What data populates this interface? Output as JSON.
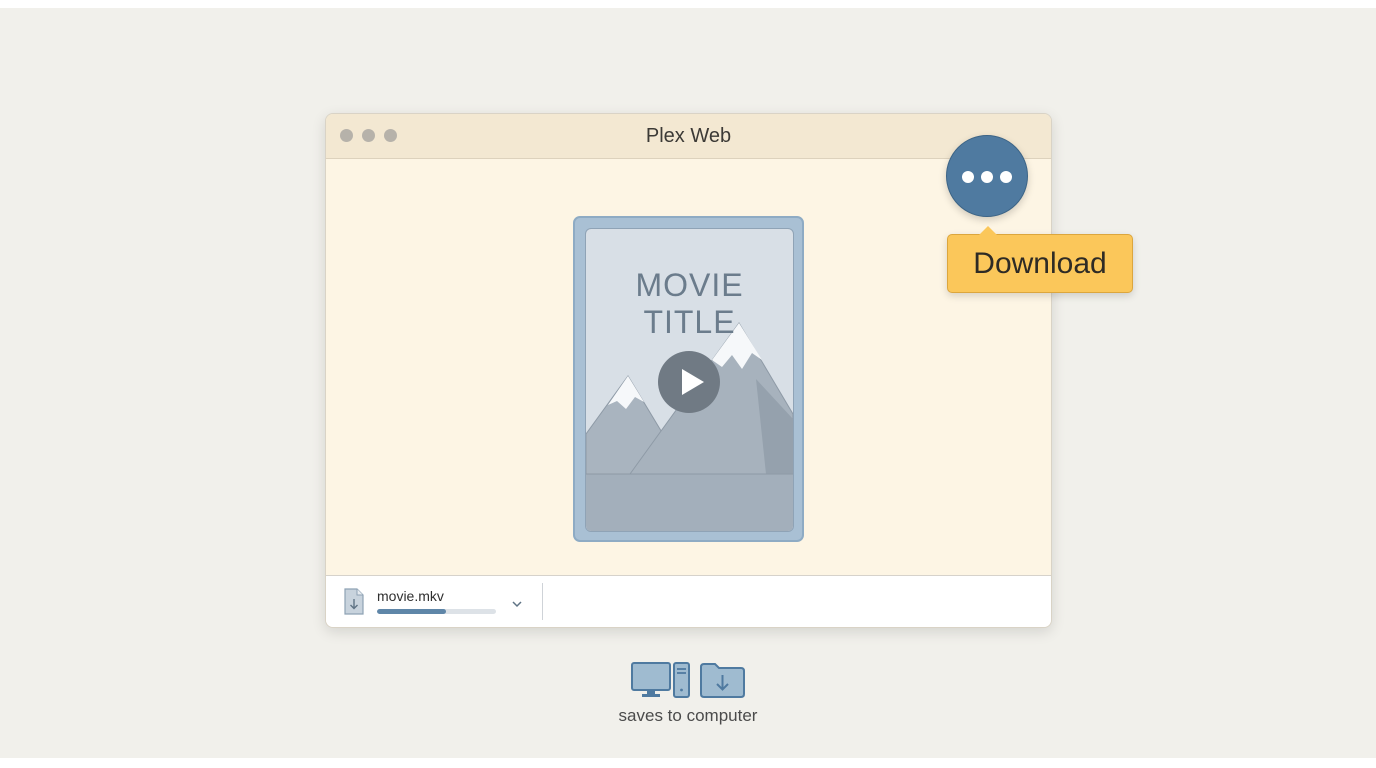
{
  "window": {
    "title": "Plex Web"
  },
  "poster": {
    "title": "MOVIE TITLE"
  },
  "download_bar": {
    "filename": "movie.mkv",
    "progress": 0.58
  },
  "menu": {
    "download_label": "Download"
  },
  "footer": {
    "caption": "saves to computer"
  },
  "icons": {
    "more": "more-horizontal-icon",
    "play": "play-icon",
    "file_download": "file-download-icon",
    "chevron": "chevron-down-icon",
    "computer": "desktop-computer-icon",
    "folder_download": "folder-download-icon"
  },
  "colors": {
    "accent_blue": "#4f7aa0",
    "popup_yellow": "#fbc75a",
    "window_bg": "#fdf5e4",
    "titlebar_bg": "#f3e8d2"
  }
}
